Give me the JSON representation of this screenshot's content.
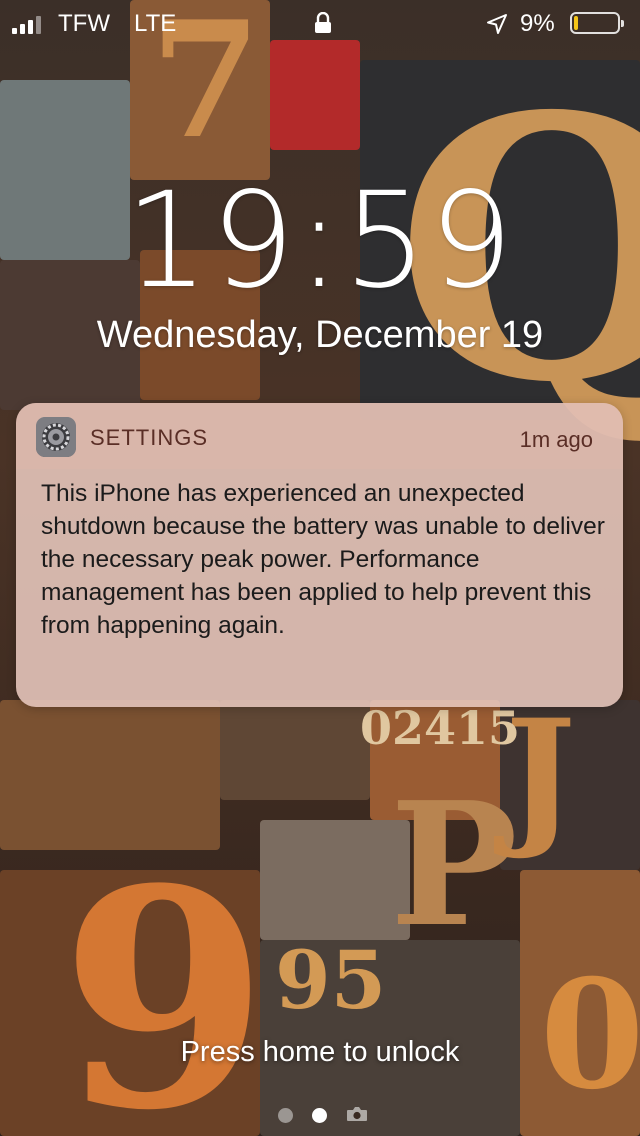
{
  "status_bar": {
    "carrier": "TFW",
    "network": "LTE",
    "battery_percent": "9%",
    "battery_level": 0.09,
    "icons": [
      "signal-icon",
      "lock-icon",
      "location-icon",
      "battery-icon"
    ]
  },
  "lock_screen": {
    "time": "19:59",
    "date": "Wednesday, December 19",
    "unlock_hint": "Press home to unlock",
    "pages": [
      "page-dot",
      "page-dot-current",
      "camera-icon"
    ]
  },
  "notification": {
    "app_name": "SETTINGS",
    "app_icon": "settings-gear-icon",
    "time_ago": "1m ago",
    "message": "This iPhone has experienced an unexpected shutdown because the battery was unable to deliver the necessary peak power. Performance management has been applied to help prevent this from happening again."
  },
  "colors": {
    "notification_bg": "#E8C8BE",
    "notification_header_text": "#5A2E26",
    "battery_low": "#F5C518"
  }
}
